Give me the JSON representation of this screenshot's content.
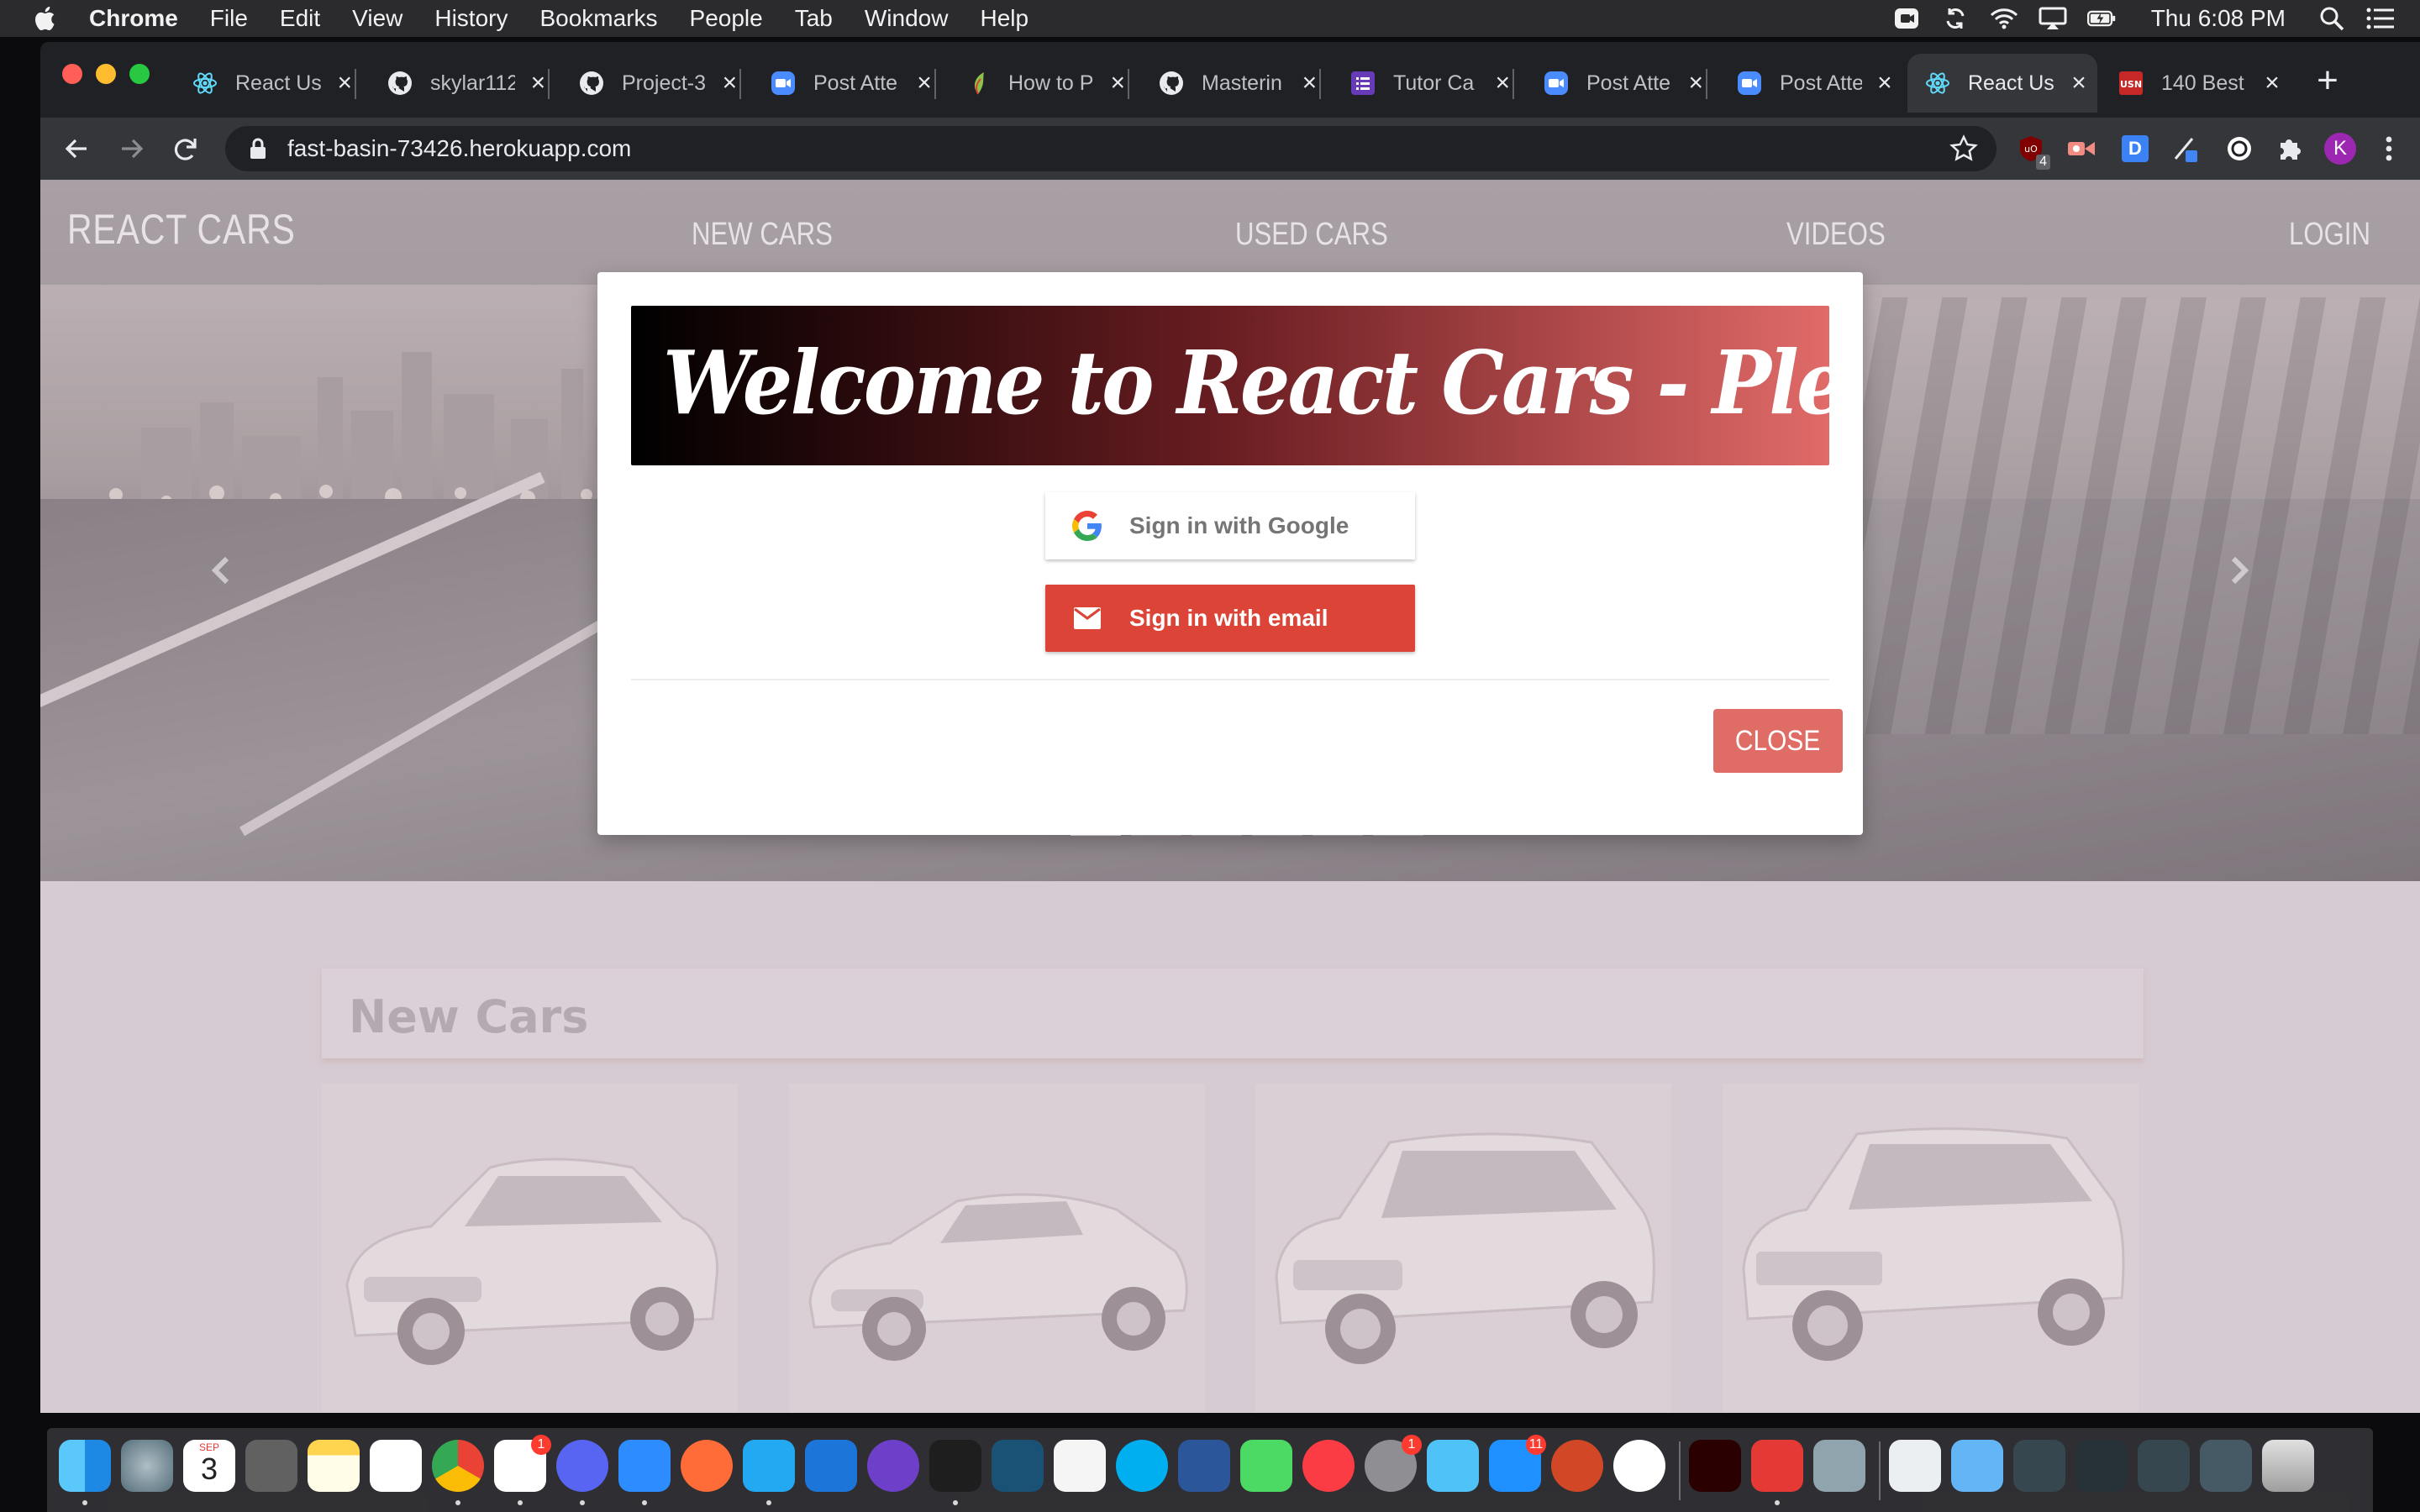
{
  "menubar": {
    "app_name": "Chrome",
    "items": [
      "File",
      "Edit",
      "View",
      "History",
      "Bookmarks",
      "People",
      "Tab",
      "Window",
      "Help"
    ],
    "clock": "Thu 6:08 PM"
  },
  "tabs": [
    {
      "title": "React Us",
      "icon": "react-icon"
    },
    {
      "title": "skylar112",
      "icon": "github-icon"
    },
    {
      "title": "Project-3",
      "icon": "github-icon"
    },
    {
      "title": "Post Atte",
      "icon": "zoom-icon"
    },
    {
      "title": "How to P",
      "icon": "leaf-icon"
    },
    {
      "title": "Masterin",
      "icon": "github-icon"
    },
    {
      "title": "Tutor Ca",
      "icon": "list-icon"
    },
    {
      "title": "Post Atte",
      "icon": "zoom-icon"
    },
    {
      "title": "Post Atte",
      "icon": "zoom-icon"
    },
    {
      "title": "React Us",
      "icon": "react-icon"
    },
    {
      "title": "140 Best",
      "icon": "usn-icon"
    }
  ],
  "active_tab_index": 9,
  "address_bar": {
    "url": "fast-basin-73426.herokuapp.com"
  },
  "extensions": {
    "ublock_badge": "4",
    "d_label": "D",
    "profile_initial": "K"
  },
  "site": {
    "brand": "REACT CARS",
    "nav": {
      "new_cars": "NEW CARS",
      "used_cars": "USED CARS",
      "videos": "VIDEOS",
      "login": "LOGIN"
    },
    "carousel_slide_count": 6,
    "carousel_active_index": 0,
    "section_title": "New Cars",
    "cars": [
      {
        "name": "sedan-car-image"
      },
      {
        "name": "roadster-car-image"
      },
      {
        "name": "compact-suv-image"
      },
      {
        "name": "large-suv-image"
      }
    ]
  },
  "modal": {
    "title": "Welcome to React Cars  - Please log in",
    "google_button": "Sign in with Google",
    "email_button": "Sign in with email",
    "close_button": "CLOSE"
  },
  "dock": {
    "calendar_month": "SEP",
    "calendar_day": "3",
    "badges": {
      "slack": "1",
      "settings": "1",
      "appstore": "11"
    }
  },
  "colors": {
    "modal_banner_start": "#000000",
    "modal_banner_end": "#e06b68",
    "email_button": "#db4437",
    "close_button": "#e06c66"
  }
}
